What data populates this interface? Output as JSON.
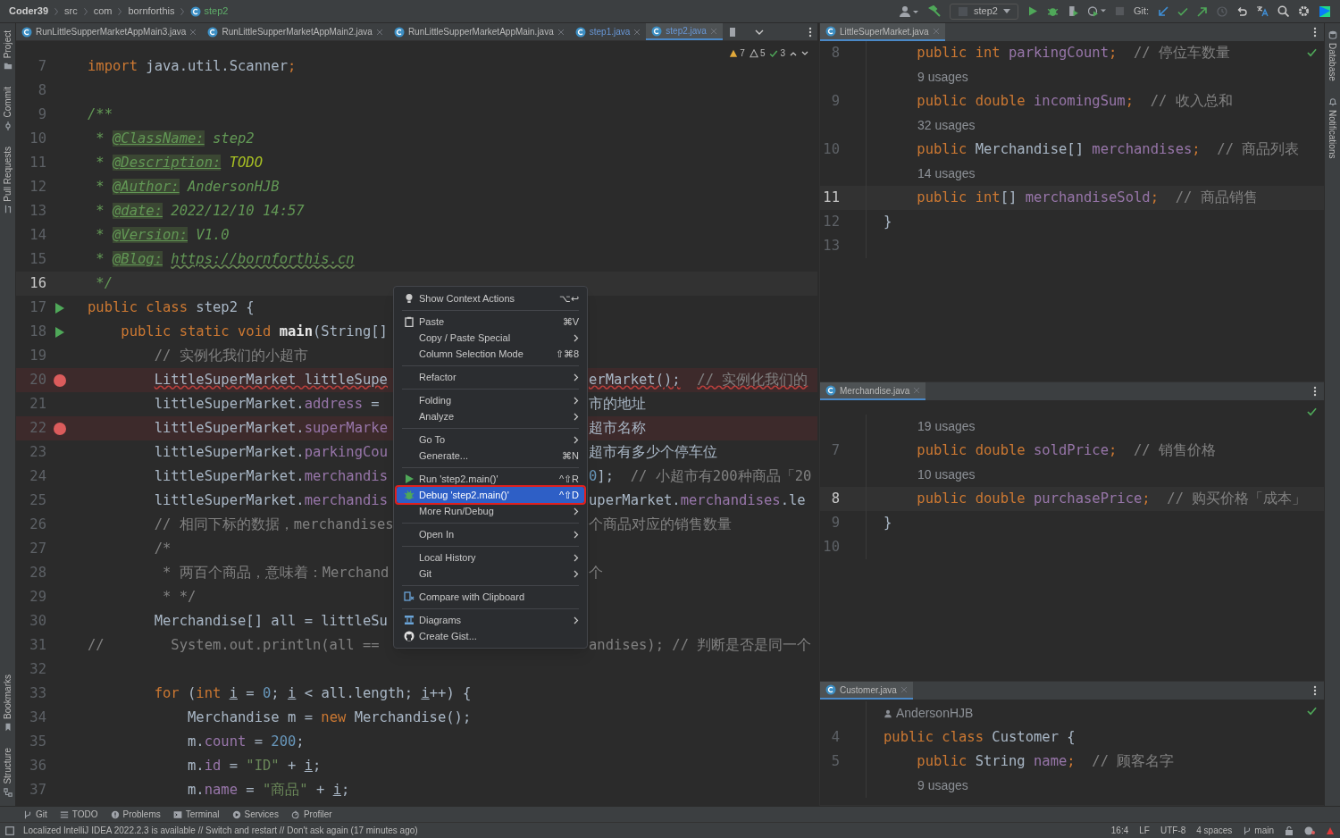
{
  "breadcrumbs": [
    {
      "text": "Coder39",
      "kind": "project"
    },
    {
      "text": "src",
      "kind": "folder"
    },
    {
      "text": "com",
      "kind": "folder"
    },
    {
      "text": "bornforthis",
      "kind": "folder"
    },
    {
      "text": "step2",
      "kind": "class"
    }
  ],
  "toolbar": {
    "run_config": "step2",
    "git_label": "Git:"
  },
  "left_tools": [
    {
      "label": "Project",
      "kind": "folder"
    },
    {
      "label": "Commit",
      "kind": "commit"
    },
    {
      "label": "Pull Requests",
      "kind": "pr"
    },
    {
      "label": "Bookmarks",
      "kind": "bookmark"
    },
    {
      "label": "Structure",
      "kind": "structure"
    }
  ],
  "right_tools": [
    {
      "label": "Database",
      "kind": "database"
    },
    {
      "label": "Notifications",
      "kind": "bell"
    }
  ],
  "editor_tabs": [
    {
      "label": "RunLittleSupperMarketAppMain3.java",
      "selected": false,
      "changed": false
    },
    {
      "label": "RunLittleSupperMarketAppMain2.java",
      "selected": false,
      "changed": false
    },
    {
      "label": "RunLittleSupperMarketAppMain.java",
      "selected": false,
      "changed": false
    },
    {
      "label": "step1.java",
      "selected": false,
      "changed": true
    },
    {
      "label": "step2.java",
      "selected": true,
      "changed": true
    }
  ],
  "inspections": [
    {
      "kind": "warning",
      "count": "7"
    },
    {
      "kind": "weak",
      "count": "5"
    },
    {
      "kind": "ok",
      "count": "3"
    }
  ],
  "editor": {
    "lines": [
      {
        "number": "7",
        "run": false,
        "breakpoint": false,
        "current": false,
        "tokens": [
          {
            "kind": "keyword",
            "text": "import"
          },
          {
            "kind": "plain",
            "text": " java.util.Scanner"
          },
          {
            "kind": "keyword",
            "text": ";"
          }
        ]
      },
      {
        "number": "8",
        "run": false,
        "breakpoint": false,
        "current": false
      },
      {
        "number": "9",
        "run": false,
        "breakpoint": false,
        "current": false,
        "tokens": [
          {
            "kind": "doc",
            "text": "/**"
          }
        ]
      },
      {
        "number": "10",
        "run": false,
        "breakpoint": false,
        "current": false,
        "tokens": [
          {
            "kind": "doc",
            "text": " * "
          },
          {
            "kind": "doctag",
            "text": "@ClassName:"
          },
          {
            "kind": "doc",
            "text": " step2"
          }
        ]
      },
      {
        "number": "11",
        "run": false,
        "breakpoint": false,
        "current": false,
        "tokens": [
          {
            "kind": "doc",
            "text": " * "
          },
          {
            "kind": "doctag",
            "text": "@Description:"
          },
          {
            "kind": "todo",
            "text": " TODO"
          }
        ]
      },
      {
        "number": "12",
        "run": false,
        "breakpoint": false,
        "current": false,
        "tokens": [
          {
            "kind": "doc",
            "text": " * "
          },
          {
            "kind": "doctag",
            "text": "@Author:"
          },
          {
            "kind": "doc",
            "text": " AndersonHJB"
          }
        ]
      },
      {
        "number": "13",
        "run": false,
        "breakpoint": false,
        "current": false,
        "tokens": [
          {
            "kind": "doc",
            "text": " * "
          },
          {
            "kind": "doctag",
            "text": "@date:"
          },
          {
            "kind": "doc",
            "text": " 2022/12/10 14:57"
          }
        ]
      },
      {
        "number": "14",
        "run": false,
        "breakpoint": false,
        "current": false,
        "tokens": [
          {
            "kind": "doc",
            "text": " * "
          },
          {
            "kind": "doctag",
            "text": "@Version:"
          },
          {
            "kind": "doc",
            "text": " V1.0"
          }
        ]
      },
      {
        "number": "15",
        "run": false,
        "breakpoint": false,
        "current": false,
        "tokens": [
          {
            "kind": "doc",
            "text": " * "
          },
          {
            "kind": "doctag",
            "text": "@Blog:"
          },
          {
            "kind": "link",
            "text": " https://bornforthis.cn"
          }
        ]
      },
      {
        "number": "16",
        "run": false,
        "breakpoint": false,
        "current": true,
        "tokens": [
          {
            "kind": "doc",
            "text": " */"
          }
        ]
      },
      {
        "number": "17",
        "run": true,
        "breakpoint": false,
        "current": false,
        "tokens": [
          {
            "kind": "keyword",
            "text": "public class "
          },
          {
            "kind": "plain",
            "text": "step2 {"
          }
        ]
      },
      {
        "number": "18",
        "run": true,
        "breakpoint": false,
        "current": false,
        "tokens": [
          {
            "kind": "keyword",
            "text": "    public static void "
          },
          {
            "kind": "method",
            "text": "main"
          },
          {
            "kind": "plain",
            "text": "(String[]"
          }
        ]
      },
      {
        "number": "19",
        "run": false,
        "breakpoint": false,
        "current": false,
        "tokens": [
          {
            "kind": "comment",
            "text": "        // 实例化我们的小超市"
          }
        ]
      },
      {
        "number": "20",
        "run": false,
        "breakpoint": true,
        "current": false,
        "tokens": [
          {
            "kind": "error",
            "text": "        LittleSuperMarket littleSupe"
          }
        ],
        "after_menu": [
          {
            "kind": "error",
            "text": "erMarket();"
          },
          {
            "kind": "errorcomment",
            "text": "  // 实例化我们的"
          }
        ]
      },
      {
        "number": "21",
        "run": false,
        "breakpoint": false,
        "current": false,
        "tokens": [
          {
            "kind": "plain",
            "text": "        littleSuperMarket."
          },
          {
            "kind": "field",
            "text": "address"
          },
          {
            "kind": "plain",
            "text": " ="
          }
        ],
        "after_menu": [
          {
            "kind": "plain",
            "text": "市的地址"
          }
        ]
      },
      {
        "number": "22",
        "run": false,
        "breakpoint": true,
        "current": false,
        "tokens": [
          {
            "kind": "plain",
            "text": "        littleSuperMarket."
          },
          {
            "kind": "field",
            "text": "superMarke"
          }
        ],
        "after_menu": [
          {
            "kind": "plain",
            "text": "超市名称"
          }
        ]
      },
      {
        "number": "23",
        "run": false,
        "breakpoint": false,
        "current": false,
        "tokens": [
          {
            "kind": "plain",
            "text": "        littleSuperMarket."
          },
          {
            "kind": "field",
            "text": "parkingCou"
          }
        ],
        "after_menu": [
          {
            "kind": "plain",
            "text": "超市有多少个停车位"
          }
        ]
      },
      {
        "number": "24",
        "run": false,
        "breakpoint": false,
        "current": false,
        "tokens": [
          {
            "kind": "plain",
            "text": "        littleSuperMarket."
          },
          {
            "kind": "field",
            "text": "merchandis"
          }
        ],
        "after_menu": [
          {
            "kind": "number",
            "text": "0"
          },
          {
            "kind": "plain",
            "text": "];"
          },
          {
            "kind": "comment",
            "text": "  // 小超市有200种商品「20"
          }
        ]
      },
      {
        "number": "25",
        "run": false,
        "breakpoint": false,
        "current": false,
        "tokens": [
          {
            "kind": "plain",
            "text": "        littleSuperMarket."
          },
          {
            "kind": "field",
            "text": "merchandis"
          }
        ],
        "after_menu": [
          {
            "kind": "plain",
            "text": "uperMarket."
          },
          {
            "kind": "field",
            "text": "merchandises"
          },
          {
            "kind": "plain",
            "text": ".le"
          }
        ]
      },
      {
        "number": "26",
        "run": false,
        "breakpoint": false,
        "current": false,
        "tokens": [
          {
            "kind": "comment",
            "text": "        // 相同下标的数据，merchandises"
          }
        ],
        "after_menu": [
          {
            "kind": "comment",
            "text": "个商品对应的销售数量"
          }
        ]
      },
      {
        "number": "27",
        "run": false,
        "breakpoint": false,
        "current": false,
        "tokens": [
          {
            "kind": "comment",
            "text": "        /*"
          }
        ]
      },
      {
        "number": "28",
        "run": false,
        "breakpoint": false,
        "current": false,
        "tokens": [
          {
            "kind": "comment",
            "text": "         * 两百个商品，意味着：Merchand"
          }
        ],
        "after_menu": [
          {
            "kind": "comment",
            "text": "个"
          }
        ]
      },
      {
        "number": "29",
        "run": false,
        "breakpoint": false,
        "current": false,
        "tokens": [
          {
            "kind": "comment",
            "text": "         * */"
          }
        ]
      },
      {
        "number": "30",
        "run": false,
        "breakpoint": false,
        "current": false,
        "tokens": [
          {
            "kind": "plain",
            "text": "        Merchandise[] all = littleSu"
          }
        ]
      },
      {
        "number": "31",
        "run": false,
        "breakpoint": false,
        "current": false,
        "tokens": [
          {
            "kind": "comment",
            "text": "//        System.out.println(all =="
          }
        ],
        "after_menu": [
          {
            "kind": "comment",
            "text": "andises); // 判断是否是同一个"
          }
        ]
      },
      {
        "number": "32",
        "run": false,
        "breakpoint": false,
        "current": false
      },
      {
        "number": "33",
        "run": false,
        "breakpoint": false,
        "current": false,
        "tokens": [
          {
            "kind": "keyword",
            "text": "        for "
          },
          {
            "kind": "plain",
            "text": "("
          },
          {
            "kind": "keyword",
            "text": "int "
          },
          {
            "kind": "var",
            "text": "i"
          },
          {
            "kind": "plain",
            "text": " = "
          },
          {
            "kind": "number",
            "text": "0"
          },
          {
            "kind": "plain",
            "text": "; "
          },
          {
            "kind": "var",
            "text": "i"
          },
          {
            "kind": "plain",
            "text": " < all.length; "
          },
          {
            "kind": "var",
            "text": "i"
          },
          {
            "kind": "plain",
            "text": "++) {"
          }
        ]
      },
      {
        "number": "34",
        "run": false,
        "breakpoint": false,
        "current": false,
        "tokens": [
          {
            "kind": "plain",
            "text": "            Merchandise m = "
          },
          {
            "kind": "keyword",
            "text": "new "
          },
          {
            "kind": "plain",
            "text": "Merchandise();"
          }
        ]
      },
      {
        "number": "35",
        "run": false,
        "breakpoint": false,
        "current": false,
        "tokens": [
          {
            "kind": "plain",
            "text": "            m."
          },
          {
            "kind": "field",
            "text": "count"
          },
          {
            "kind": "plain",
            "text": " = "
          },
          {
            "kind": "number",
            "text": "200"
          },
          {
            "kind": "plain",
            "text": ";"
          }
        ]
      },
      {
        "number": "36",
        "run": false,
        "breakpoint": false,
        "current": false,
        "tokens": [
          {
            "kind": "plain",
            "text": "            m."
          },
          {
            "kind": "field",
            "text": "id"
          },
          {
            "kind": "plain",
            "text": " = "
          },
          {
            "kind": "string",
            "text": "\"ID\""
          },
          {
            "kind": "plain",
            "text": " + "
          },
          {
            "kind": "var",
            "text": "i"
          },
          {
            "kind": "plain",
            "text": ";"
          }
        ]
      },
      {
        "number": "37",
        "run": false,
        "breakpoint": false,
        "current": false,
        "tokens": [
          {
            "kind": "plain",
            "text": "            m."
          },
          {
            "kind": "field",
            "text": "name"
          },
          {
            "kind": "plain",
            "text": " = "
          },
          {
            "kind": "string",
            "text": "\"商品\""
          },
          {
            "kind": "plain",
            "text": " + "
          },
          {
            "kind": "var",
            "text": "i"
          },
          {
            "kind": "plain",
            "text": ";"
          }
        ]
      }
    ]
  },
  "context_menu": {
    "items": [
      {
        "kind": "bulb",
        "label": "Show Context Actions",
        "shortcut": "⌥↩",
        "submenu": false,
        "selected": false
      },
      {
        "kind": "separator"
      },
      {
        "kind": "clipboard",
        "label": "Paste",
        "shortcut": "⌘V",
        "submenu": false,
        "selected": false
      },
      {
        "kind": "plain",
        "label": "Copy / Paste Special",
        "submenu": true,
        "selected": false
      },
      {
        "kind": "plain",
        "label": "Column Selection Mode",
        "shortcut": "⇧⌘8",
        "submenu": false,
        "selected": false
      },
      {
        "kind": "separator"
      },
      {
        "kind": "plain",
        "label": "Refactor",
        "submenu": true,
        "selected": false
      },
      {
        "kind": "separator"
      },
      {
        "kind": "plain",
        "label": "Folding",
        "submenu": true,
        "selected": false
      },
      {
        "kind": "plain",
        "label": "Analyze",
        "submenu": true,
        "selected": false
      },
      {
        "kind": "separator"
      },
      {
        "kind": "plain",
        "label": "Go To",
        "submenu": true,
        "selected": false
      },
      {
        "kind": "plain",
        "label": "Generate...",
        "shortcut": "⌘N",
        "submenu": false,
        "selected": false
      },
      {
        "kind": "separator"
      },
      {
        "kind": "run",
        "label": "Run 'step2.main()'",
        "shortcut": "^⇧R",
        "submenu": false,
        "selected": false
      },
      {
        "kind": "debug",
        "label": "Debug 'step2.main()'",
        "shortcut": "^⇧D",
        "submenu": false,
        "selected": true
      },
      {
        "kind": "plain",
        "label": "More Run/Debug",
        "submenu": true,
        "selected": false
      },
      {
        "kind": "separator"
      },
      {
        "kind": "plain",
        "label": "Open In",
        "submenu": true,
        "selected": false
      },
      {
        "kind": "separator"
      },
      {
        "kind": "plain",
        "label": "Local History",
        "submenu": true,
        "selected": false
      },
      {
        "kind": "plain",
        "label": "Git",
        "submenu": true,
        "selected": false
      },
      {
        "kind": "separator"
      },
      {
        "kind": "compare",
        "label": "Compare with Clipboard",
        "submenu": false,
        "selected": false
      },
      {
        "kind": "separator"
      },
      {
        "kind": "diagram",
        "label": "Diagrams",
        "submenu": true,
        "selected": false
      },
      {
        "kind": "github",
        "label": "Create Gist...",
        "submenu": false,
        "selected": false
      }
    ]
  },
  "split_panes": [
    {
      "tab": "LittleSuperMarket.java",
      "rows": [
        {
          "kind": "code",
          "number": "8",
          "current": false,
          "tokens": [
            {
              "kind": "keyword",
              "text": "    public int "
            },
            {
              "kind": "field",
              "text": "parkingCount"
            },
            {
              "kind": "keyword",
              "text": ";"
            },
            {
              "kind": "comment",
              "text": "  // 停位车数量"
            }
          ]
        },
        {
          "kind": "hint",
          "text": "9 usages"
        },
        {
          "kind": "code",
          "number": "9",
          "current": false,
          "tokens": [
            {
              "kind": "keyword",
              "text": "    public double "
            },
            {
              "kind": "field",
              "text": "incomingSum"
            },
            {
              "kind": "keyword",
              "text": ";"
            },
            {
              "kind": "comment",
              "text": "  // 收入总和"
            }
          ]
        },
        {
          "kind": "hint",
          "text": "32 usages"
        },
        {
          "kind": "code",
          "number": "10",
          "current": false,
          "tokens": [
            {
              "kind": "keyword",
              "text": "    public "
            },
            {
              "kind": "plain",
              "text": "Merchandise[] "
            },
            {
              "kind": "field",
              "text": "merchandises"
            },
            {
              "kind": "keyword",
              "text": ";"
            },
            {
              "kind": "comment",
              "text": "  // 商品列表"
            }
          ]
        },
        {
          "kind": "hint",
          "text": "14 usages"
        },
        {
          "kind": "code",
          "number": "11",
          "current": true,
          "tokens": [
            {
              "kind": "keyword",
              "text": "    public int"
            },
            {
              "kind": "plain",
              "text": "[] "
            },
            {
              "kind": "field",
              "text": "merchandiseSold"
            },
            {
              "kind": "keyword",
              "text": ";"
            },
            {
              "kind": "comment",
              "text": "  // 商品销售"
            }
          ]
        },
        {
          "kind": "code",
          "number": "12",
          "current": false,
          "tokens": [
            {
              "kind": "plain",
              "text": "}"
            }
          ]
        },
        {
          "kind": "code",
          "number": "13",
          "current": false
        }
      ]
    },
    {
      "tab": "Merchandise.java",
      "rows": [
        {
          "kind": "hint",
          "text": "19 usages"
        },
        {
          "kind": "code",
          "number": "7",
          "current": false,
          "tokens": [
            {
              "kind": "keyword",
              "text": "    public double "
            },
            {
              "kind": "field",
              "text": "soldPrice"
            },
            {
              "kind": "keyword",
              "text": ";"
            },
            {
              "kind": "comment",
              "text": "  // 销售价格"
            }
          ]
        },
        {
          "kind": "hint",
          "text": "10 usages"
        },
        {
          "kind": "code",
          "number": "8",
          "current": true,
          "tokens": [
            {
              "kind": "keyword",
              "text": "    public double "
            },
            {
              "kind": "field",
              "text": "purchasePrice"
            },
            {
              "kind": "keyword",
              "text": ";"
            },
            {
              "kind": "comment",
              "text": "  // 购买价格「成本」"
            }
          ]
        },
        {
          "kind": "code",
          "number": "9",
          "current": false,
          "tokens": [
            {
              "kind": "plain",
              "text": "}"
            }
          ]
        },
        {
          "kind": "code",
          "number": "10",
          "current": false
        }
      ]
    },
    {
      "tab": "Customer.java",
      "rows": [
        {
          "kind": "author",
          "text": "AndersonHJB"
        },
        {
          "kind": "code",
          "number": "4",
          "current": false,
          "tokens": [
            {
              "kind": "keyword",
              "text": "public class "
            },
            {
              "kind": "plain",
              "text": "Customer {"
            }
          ]
        },
        {
          "kind": "code",
          "number": "5",
          "current": false,
          "tokens": [
            {
              "kind": "keyword",
              "text": "    public "
            },
            {
              "kind": "plain",
              "text": "String "
            },
            {
              "kind": "field",
              "text": "name"
            },
            {
              "kind": "keyword",
              "text": ";"
            },
            {
              "kind": "comment",
              "text": "  // 顾客名字"
            }
          ]
        },
        {
          "kind": "hint",
          "text": "9 usages"
        }
      ]
    }
  ],
  "tool_windows": [
    {
      "label": "Git",
      "kind": "branch"
    },
    {
      "label": "TODO",
      "kind": "list"
    },
    {
      "label": "Problems",
      "kind": "problems"
    },
    {
      "label": "Terminal",
      "kind": "terminal"
    },
    {
      "label": "Services",
      "kind": "services"
    },
    {
      "label": "Profiler",
      "kind": "profiler"
    }
  ],
  "status_bar": {
    "message": "Localized IntelliJ IDEA 2022.2.3 is available // Switch and restart // Don't ask again (17 minutes ago)",
    "items": [
      "16:4",
      "LF",
      "UTF-8",
      "4 spaces"
    ],
    "branch": "main"
  }
}
